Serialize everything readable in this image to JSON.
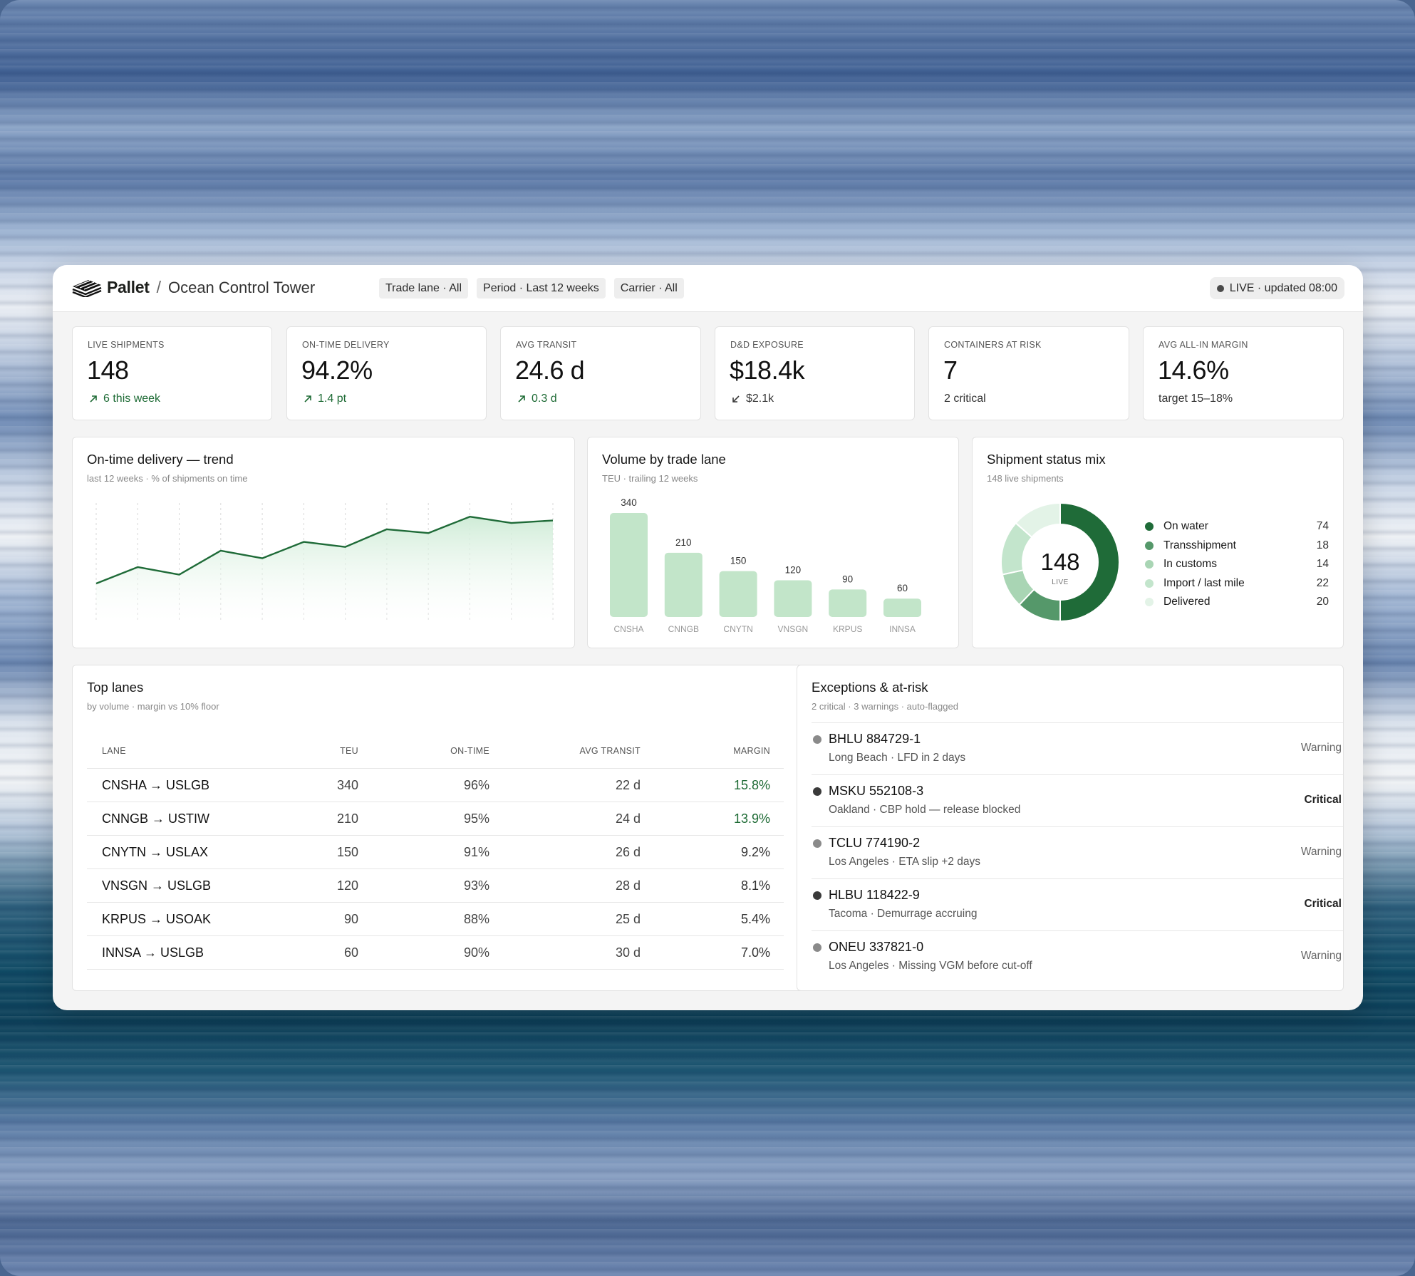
{
  "app": {
    "brand": "Pallet",
    "separator": "/",
    "page": "Ocean Control Tower"
  },
  "filters": [
    "Trade lane · All",
    "Period · Last 12 weeks",
    "Carrier · All"
  ],
  "live_status": "LIVE · updated 08:00",
  "kpis": [
    {
      "label": "LIVE SHIPMENTS",
      "value": "148",
      "sub": "6 this week",
      "trend": "up"
    },
    {
      "label": "ON-TIME DELIVERY",
      "value": "94.2%",
      "sub": "1.4 pt",
      "trend": "up"
    },
    {
      "label": "AVG TRANSIT",
      "value": "24.6 d",
      "sub": "0.3 d",
      "trend": "up"
    },
    {
      "label": "D&D EXPOSURE",
      "value": "$18.4k",
      "sub": "$2.1k",
      "trend": "down"
    },
    {
      "label": "CONTAINERS AT RISK",
      "value": "7",
      "sub": "2 critical",
      "trend": "none"
    },
    {
      "label": "AVG ALL-IN MARGIN",
      "value": "14.6%",
      "sub": "target 15–18%",
      "trend": "none"
    }
  ],
  "trend_card": {
    "title": "On-time delivery — trend",
    "subtitle": "last 12 weeks · % of shipments on time"
  },
  "volume_card": {
    "title": "Volume by trade lane",
    "subtitle": "TEU · trailing 12 weeks"
  },
  "status_card": {
    "title": "Shipment status mix",
    "subtitle": "148 live shipments",
    "center_value": "148",
    "center_label": "LIVE"
  },
  "colors": {
    "accent_dark": "#1f6b38",
    "accent_mid": "#55986a",
    "accent_light": "#a9d5b4",
    "accent_pale": "#c3e5cc",
    "accent_faint": "#e3f3e7",
    "bar": "#c2e5c9"
  },
  "chart_data": [
    {
      "type": "line",
      "x": [
        1,
        2,
        3,
        4,
        5,
        6,
        7,
        8,
        9,
        10,
        11,
        12
      ],
      "values": [
        91.0,
        92.3,
        91.7,
        93.6,
        93.0,
        94.3,
        93.9,
        95.3,
        95.0,
        96.3,
        95.8,
        96.0
      ],
      "ylim": [
        88,
        97.5
      ],
      "grid": "vertical"
    },
    {
      "type": "bar",
      "categories": [
        "CNSHA",
        "CNNGB",
        "CNYTN",
        "VNSGN",
        "KRPUS",
        "INNSA"
      ],
      "values": [
        340,
        210,
        150,
        120,
        90,
        60
      ],
      "ylim": [
        0,
        340
      ]
    },
    {
      "type": "pie",
      "categories": [
        "On water",
        "Transshipment",
        "In customs",
        "Import / last mile",
        "Delivered"
      ],
      "values": [
        74,
        18,
        14,
        22,
        20
      ]
    }
  ],
  "legend_colors": [
    "#1f6b38",
    "#55986a",
    "#a9d5b4",
    "#c3e5cc",
    "#e3f3e7"
  ],
  "top_lanes": {
    "title": "Top lanes",
    "subtitle": "by volume · margin vs 10% floor",
    "headers": [
      "LANE",
      "TEU",
      "ON-TIME",
      "AVG TRANSIT",
      "MARGIN"
    ],
    "rows": [
      {
        "lane": "CNSHA → USLGB",
        "teu": "340",
        "ontime": "96%",
        "transit": "22 d",
        "margin": "15.8%",
        "good": true
      },
      {
        "lane": "CNNGB → USTIW",
        "teu": "210",
        "ontime": "95%",
        "transit": "24 d",
        "margin": "13.9%",
        "good": true
      },
      {
        "lane": "CNYTN → USLAX",
        "teu": "150",
        "ontime": "91%",
        "transit": "26 d",
        "margin": "9.2%",
        "good": false
      },
      {
        "lane": "VNSGN → USLGB",
        "teu": "120",
        "ontime": "93%",
        "transit": "28 d",
        "margin": "8.1%",
        "good": false
      },
      {
        "lane": "KRPUS → USOAK",
        "teu": "90",
        "ontime": "88%",
        "transit": "25 d",
        "margin": "5.4%",
        "good": false
      },
      {
        "lane": "INNSA → USLGB",
        "teu": "60",
        "ontime": "90%",
        "transit": "30 d",
        "margin": "7.0%",
        "good": false
      }
    ]
  },
  "exceptions": {
    "title": "Exceptions & at-risk",
    "subtitle": "2 critical · 3 warnings · auto-flagged",
    "items": [
      {
        "id": "BHLU 884729-1",
        "desc": "Long Beach · LFD in 2 days",
        "severity": "Warning"
      },
      {
        "id": "MSKU 552108-3",
        "desc": "Oakland · CBP hold — release blocked",
        "severity": "Critical"
      },
      {
        "id": "TCLU 774190-2",
        "desc": "Los Angeles · ETA slip +2 days",
        "severity": "Warning"
      },
      {
        "id": "HLBU 118422-9",
        "desc": "Tacoma · Demurrage accruing",
        "severity": "Critical"
      },
      {
        "id": "ONEU 337821-0",
        "desc": "Los Angeles · Missing VGM before cut-off",
        "severity": "Warning"
      }
    ]
  }
}
